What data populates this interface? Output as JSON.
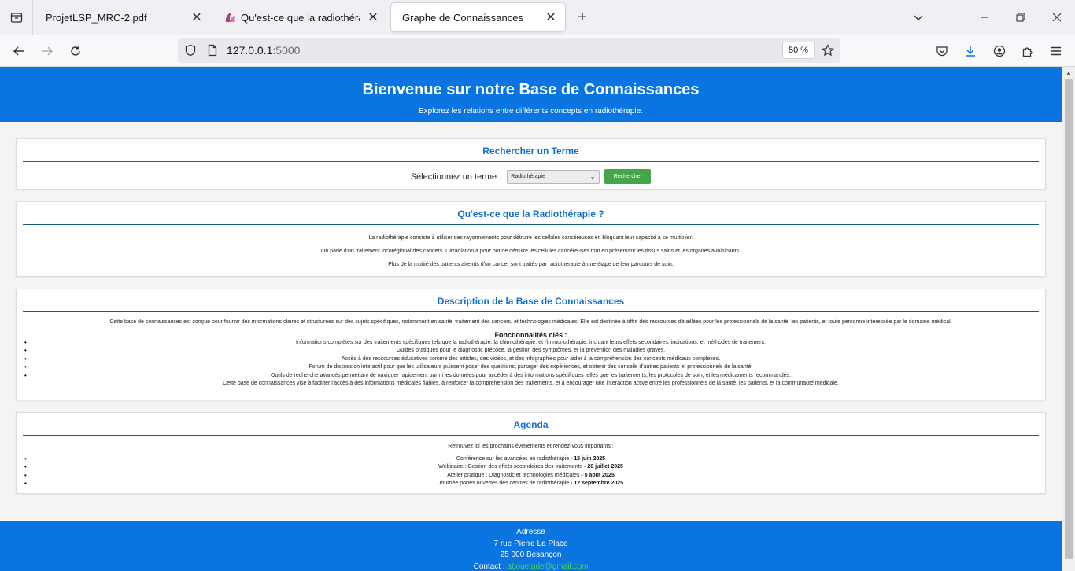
{
  "browser": {
    "tabs": [
      {
        "title": "ProjetLSP_MRC-2.pdf",
        "active": false
      },
      {
        "title": "Qu'est-ce que la radiothérapie ?",
        "active": false
      },
      {
        "title": "Graphe de Connaissances",
        "active": true
      }
    ],
    "url_host": "127.0.0.1",
    "url_port": ":5000",
    "zoom": "50 %"
  },
  "header": {
    "title": "Bienvenue sur notre Base de Connaissances",
    "subtitle": "Explorez les relations entre différents concepts en radiothérapie."
  },
  "search": {
    "heading": "Rechercher un Terme",
    "label": "Sélectionnez un terme :",
    "selected_term": "Radiothérapie",
    "button": "Rechercher"
  },
  "about": {
    "heading": "Qu'est-ce que la Radiothérapie ?",
    "paragraphs": [
      "La radiothérapie consiste à utiliser des rayonnements pour détruire les cellules cancéreuses en bloquant leur capacité à se multiplier.",
      "On parle d'un traitement locorégional des cancers. L'irradiation a pour but de détruire les cellules cancéreuses tout en préservant les tissus sains et les organes avoisinants.",
      "Plus de la moitié des patients atteints d'un cancer sont traités par radiothérapie à une étape de leur parcours de soin."
    ]
  },
  "description": {
    "heading": "Description de la Base de Connaissances",
    "intro": "Cette base de connaissances est conçue pour fournir des informations claires et structurées sur des sujets spécifiques, notamment en santé, traitement des cancers, et technologies médicales. Elle est destinée à offrir des ressources détaillées pour les professionnels de la santé, les patients, et toute personne intéressée par le domaine médical.",
    "features_title": "Fonctionnalités clés :",
    "features": [
      "Informations complètes sur des traitements spécifiques tels que la radiothérapie, la chimiothérapie, et l'immunothérapie, incluant leurs effets secondaires, indications, et méthodes de traitement.",
      "Guides pratiques pour le diagnostic précoce, la gestion des symptômes, et la prévention des maladies graves.",
      "Accès à des ressources éducatives comme des articles, des vidéos, et des infographies pour aider à la compréhension des concepts médicaux complexes.",
      "Forum de discussion interactif pour que les utilisateurs puissent poser des questions, partager des expériences, et obtenir des conseils d'autres patients et professionnels de la santé.",
      "Outils de recherche avancés permettant de naviguer rapidement parmi les données pour accéder à des informations spécifiques telles que les traitements, les protocoles de soin, et les médicaments recommandés."
    ],
    "outro": "Cette base de connaissances vise à faciliter l'accès à des informations médicales fiables, à renforcer la compréhension des traitements, et à encourager une interaction active entre les professionnels de la santé, les patients, et la communauté médicale."
  },
  "agenda": {
    "heading": "Agenda",
    "intro": "Retrouvez ici les prochains événements et rendez-vous importants :",
    "events": [
      {
        "name": "Conférence sur les avancées en radiothérapie",
        "date": "15 juin 2025"
      },
      {
        "name": "Webinaire : Gestion des effets secondaires des traitements",
        "date": "20 juillet 2025"
      },
      {
        "name": "Atelier pratique : Diagnostic et technologies médicales",
        "date": "5 août 2025"
      },
      {
        "name": "Journée portes ouvertes des centres de radiothérapie",
        "date": "12 septembre 2025"
      }
    ],
    "separator": " - "
  },
  "footer": {
    "address_label": "Adresse",
    "street": "7 rue Pierre La Place",
    "city": "25 000 Besançon",
    "contact_label": "Contact : ",
    "email": "abouetude@gmail.com"
  },
  "colors": {
    "brand_blue": "#0a75e0",
    "heading_blue": "#1572c9",
    "button_green": "#45a649",
    "email_green": "#4ed26a"
  }
}
